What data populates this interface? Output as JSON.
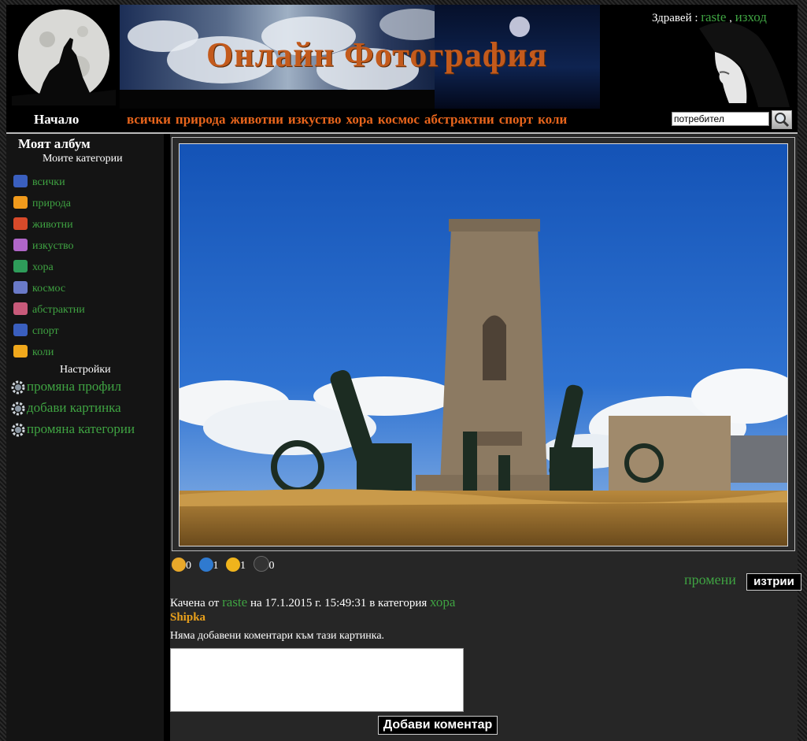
{
  "header": {
    "site_title": "Онлайн Фотография",
    "greeting_prefix": "Здравей :",
    "username": "raste",
    "separator": ",",
    "logout": "изход"
  },
  "nav": {
    "home": "Начало",
    "categories": [
      "всички",
      "природа",
      "животни",
      "изкуство",
      "хора",
      "космос",
      "абстрактни",
      "спорт",
      "коли"
    ],
    "user_search_value": "потребител"
  },
  "sidebar": {
    "album_title": "Моят албум",
    "categories_title": "Моите категории",
    "categories": [
      "всички",
      "природа",
      "животни",
      "изкуство",
      "хора",
      "космос",
      "абстрактни",
      "спорт",
      "коли"
    ],
    "settings_title": "Настройки",
    "settings": [
      "промяна профил",
      "добави картинка",
      "промяна категории"
    ]
  },
  "photo": {
    "stats": {
      "likes": "0",
      "globe": "1",
      "stars": "1",
      "dark_stars": "0"
    },
    "edit_label": "промени",
    "delete_label": "изтрии",
    "uploaded_by_label": "Качена от",
    "uploader": "raste",
    "date_label": "на 17.1.2015 г. 15:49:31",
    "category_label": "в категория",
    "category": "хора",
    "name": "Shipka"
  },
  "comments": {
    "empty_message": "Няма добавени коментари към тази картинка.",
    "add_label": "Добави коментар"
  },
  "colors": {
    "link_green": "#3fa342",
    "nav_orange": "#e8651c",
    "title_orange": "#c35a1c"
  }
}
